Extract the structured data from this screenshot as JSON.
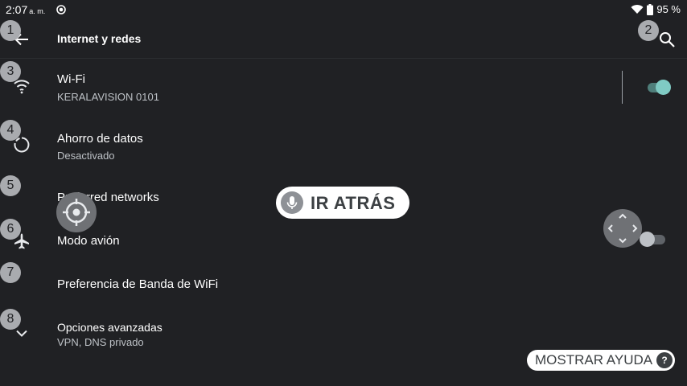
{
  "status": {
    "time": "2:07",
    "ampm": "a. m.",
    "battery": "95 %"
  },
  "app_bar": {
    "title": "Internet y redes"
  },
  "rows": [
    {
      "title": "Wi-Fi",
      "subtitle": "KERALAVISION 0101",
      "toggle": "on"
    },
    {
      "title": "Ahorro de datos",
      "subtitle": "Desactivado"
    },
    {
      "title": "Preferred networks"
    },
    {
      "title": "Modo avión",
      "toggle": "off"
    },
    {
      "title": "Preferencia de Banda de WiFi"
    },
    {
      "title": "Opciones avanzadas",
      "subtitle": "VPN, DNS privado"
    }
  ],
  "badges": [
    "1",
    "2",
    "3",
    "4",
    "5",
    "6",
    "7",
    "8"
  ],
  "overlay": {
    "go_back_label": "IR ATRÁS",
    "help_label": "MOSTRAR AYUDA",
    "help_icon": "?"
  },
  "colors": {
    "background": "#202124",
    "accent": "#80cbc4",
    "toggle_on_track": "#4f7f7b",
    "badge": "#a9abaf"
  },
  "icons": [
    "back-arrow-icon",
    "search-icon",
    "wifi-icon",
    "data-saver-icon",
    "airplane-icon",
    "chevron-down-icon",
    "mic-icon",
    "crosshair-icon",
    "dpad-icon"
  ]
}
